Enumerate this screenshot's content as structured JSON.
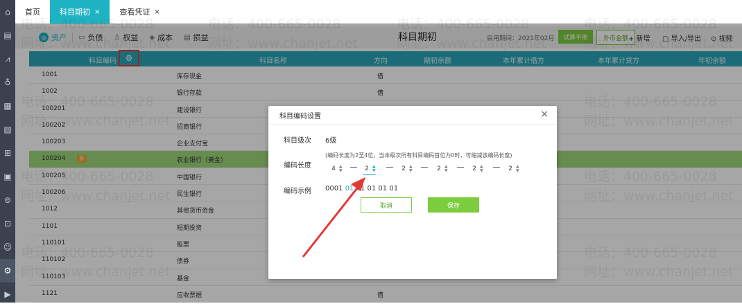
{
  "sidebar": {
    "icons": [
      "home-icon",
      "document-icon",
      "chart-icon",
      "money-bag-icon",
      "ledger-icon",
      "report-icon",
      "voucher-icon",
      "statement-icon",
      "cash-icon",
      "invoice-icon",
      "contact-icon",
      "settings-icon",
      "play-icon"
    ]
  },
  "tabs": [
    {
      "label": "首页"
    },
    {
      "label": "科目期初",
      "close": "×"
    },
    {
      "label": "查看凭证",
      "close": "×"
    }
  ],
  "toolbar": {
    "categories": [
      {
        "label": "资产"
      },
      {
        "label": "负债"
      },
      {
        "label": "权益"
      },
      {
        "label": "成本"
      },
      {
        "label": "损益"
      }
    ],
    "page_title": "科目期初",
    "start_period": "启用期间：2021年02月",
    "trial_balance": "试算平衡",
    "foreign_currency": "外币金额",
    "add": "+ 新增",
    "import_export": "导入/导出",
    "video": "视频"
  },
  "table": {
    "headers": [
      "科目编码",
      "科目名称",
      "方向",
      "期初余额",
      "本年累计借方",
      "本年累计贷方",
      "年初余额"
    ],
    "rows": [
      {
        "code": "1001",
        "name": "库存现金",
        "dir": "借"
      },
      {
        "code": "1002",
        "name": "银行存款",
        "dir": "借"
      },
      {
        "code": "100201",
        "name": "建设银行",
        "dir": ""
      },
      {
        "code": "100202",
        "name": "招商银行",
        "dir": ""
      },
      {
        "code": "100203",
        "name": "企业支付宝",
        "dir": ""
      },
      {
        "code": "100204",
        "name": "农业银行（美金）",
        "dir": "",
        "badge": "外"
      },
      {
        "code": "100205",
        "name": "中国银行",
        "dir": ""
      },
      {
        "code": "100206",
        "name": "民生银行",
        "dir": ""
      },
      {
        "code": "1012",
        "name": "其他货币资金",
        "dir": ""
      },
      {
        "code": "1101",
        "name": "短期投资",
        "dir": ""
      },
      {
        "code": "110101",
        "name": "股票",
        "dir": ""
      },
      {
        "code": "110102",
        "name": "债券",
        "dir": ""
      },
      {
        "code": "110103",
        "name": "基金",
        "dir": ""
      },
      {
        "code": "1121",
        "name": "应收票据",
        "dir": "借"
      }
    ]
  },
  "watermark": {
    "phone": "电话：400-665-0028",
    "site": "网址：www.chanjet.net"
  },
  "modal": {
    "title": "科目编码设置",
    "close": "×",
    "level_label": "科目级次",
    "level_value": "6级",
    "length_label": "编码长度",
    "hint": "(编码长度为2至4位，当本级次所有科目编码首位为0时，可缩减该编码长度)",
    "lengths": [
      "4",
      "2",
      "2",
      "2",
      "2",
      "2"
    ],
    "example_label": "编码示例",
    "example_parts": [
      "0001",
      "01",
      "01",
      "01",
      "01",
      "01"
    ],
    "cancel": "取消",
    "save": "保存"
  }
}
